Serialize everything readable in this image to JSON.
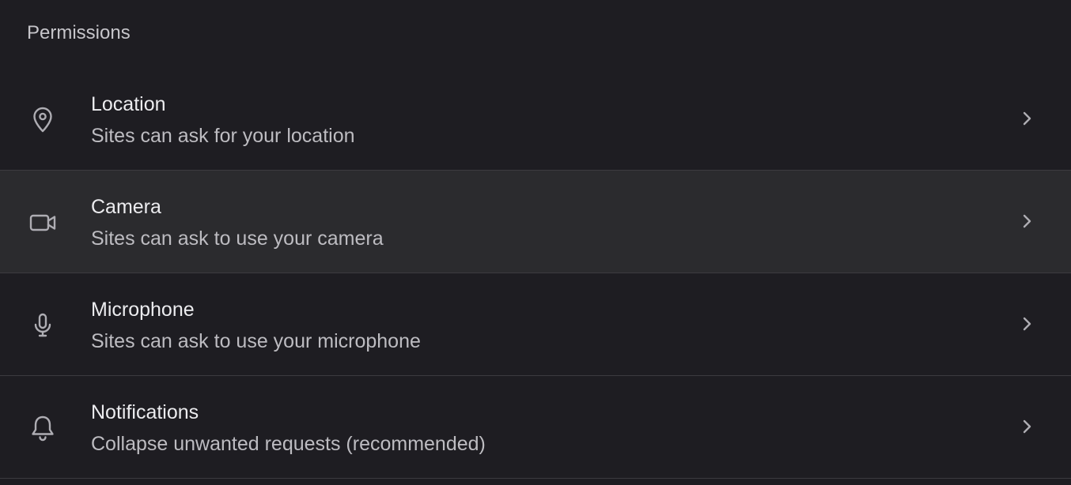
{
  "section": {
    "title": "Permissions"
  },
  "rows": [
    {
      "label": "Location",
      "sublabel": "Sites can ask for your location",
      "icon": "location-pin-icon"
    },
    {
      "label": "Camera",
      "sublabel": "Sites can ask to use your camera",
      "icon": "camera-icon",
      "hovered": true
    },
    {
      "label": "Microphone",
      "sublabel": "Sites can ask to use your microphone",
      "icon": "microphone-icon"
    },
    {
      "label": "Notifications",
      "sublabel": "Collapse unwanted requests (recommended)",
      "icon": "bell-icon"
    }
  ],
  "colors": {
    "background": "#1e1d22",
    "row_hover": "#2b2b2e",
    "divider": "#3c3b40",
    "text_primary": "#ececef",
    "text_secondary": "#bdbcc1",
    "icon": "#aeadb3"
  }
}
